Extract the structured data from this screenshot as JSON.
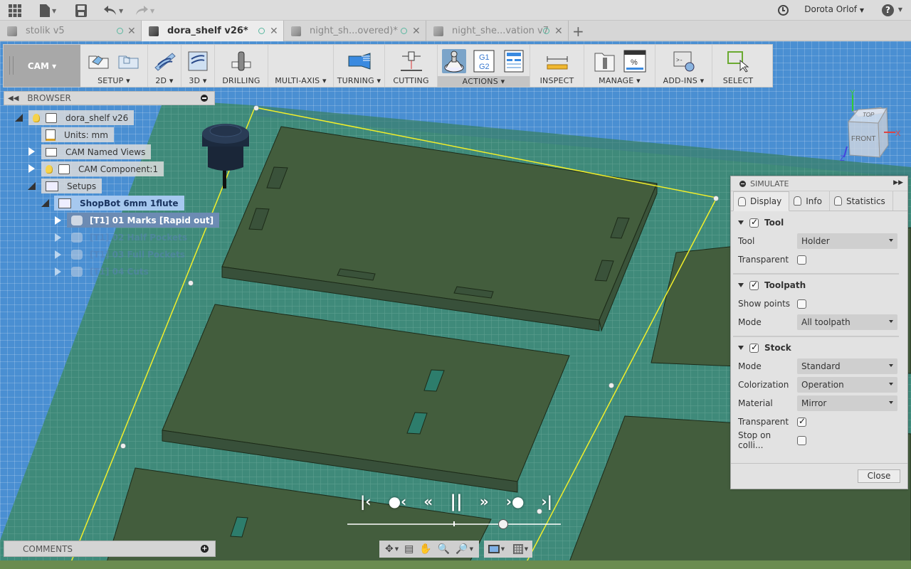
{
  "app_bar": {
    "icons": [
      "apps-grid-icon",
      "file-menu-icon",
      "save-icon",
      "undo-icon",
      "redo-icon"
    ],
    "user_name": "Dorota Orlof",
    "help_label": "?"
  },
  "tabs": [
    {
      "label": "stolik v5",
      "active": false
    },
    {
      "label": "dora_shelf v26*",
      "active": true
    },
    {
      "label": "night_sh...overed)*",
      "active": false
    },
    {
      "label": "night_she...vation v7",
      "active": false
    }
  ],
  "new_tab_label": "+",
  "toolbar": {
    "workspace": "CAM ▾",
    "groups": [
      {
        "label": "SETUP ▾"
      },
      {
        "label": "2D ▾"
      },
      {
        "label": "3D ▾"
      },
      {
        "label": "DRILLING"
      },
      {
        "label": "MULTI-AXIS ▾"
      },
      {
        "label": "TURNING ▾"
      },
      {
        "label": "CUTTING"
      },
      {
        "label": "ACTIONS ▾"
      },
      {
        "label": "INSPECT"
      },
      {
        "label": "MANAGE ▾"
      },
      {
        "label": "ADD-INS ▾"
      },
      {
        "label": "SELECT"
      }
    ],
    "actions_g_code": [
      "G1",
      "G2"
    ],
    "manage_percent": "%"
  },
  "browser": {
    "title": "BROWSER",
    "tree": [
      {
        "label": "dora_shelf v26",
        "state": "open"
      },
      {
        "label": "Units: mm"
      },
      {
        "label": "CAM Named Views",
        "state": "closed"
      },
      {
        "label": "CAM Component:1",
        "state": "closed"
      },
      {
        "label": "Setups",
        "state": "open"
      },
      {
        "label": "ShopBot 6mm 1flute",
        "state": "open"
      },
      {
        "label": "[T1] 01 Marks [Rapid out]",
        "state": "closed",
        "selected": true
      },
      {
        "label": "[T1] 02 Half Pockets",
        "state": "closed",
        "dimmed": true
      },
      {
        "label": "[T1] 03 Full Pockets",
        "state": "closed",
        "dimmed": true
      },
      {
        "label": "[T1] 04 Cuts",
        "state": "closed",
        "dimmed": true
      }
    ]
  },
  "comments": {
    "title": "COMMENTS"
  },
  "view_cube": {
    "top": "TOP",
    "front": "FRONT",
    "axes": [
      "Y",
      "X",
      "Z"
    ]
  },
  "simulate": {
    "title": "SIMULATE",
    "tabs": [
      {
        "label": "Display",
        "active": true
      },
      {
        "label": "Info",
        "active": false
      },
      {
        "label": "Statistics",
        "active": false
      }
    ],
    "tool_section": {
      "title": "Tool",
      "enabled": true,
      "tool_label": "Tool",
      "tool_value": "Holder",
      "transparent_label": "Transparent",
      "transparent": false
    },
    "toolpath_section": {
      "title": "Toolpath",
      "enabled": true,
      "show_points_label": "Show points",
      "show_points": false,
      "mode_label": "Mode",
      "mode_value": "All toolpath"
    },
    "stock_section": {
      "title": "Stock",
      "enabled": true,
      "mode_label": "Mode",
      "mode_value": "Standard",
      "colorization_label": "Colorization",
      "colorization_value": "Operation",
      "material_label": "Material",
      "material_value": "Mirror",
      "transparent_label": "Transparent",
      "transparent": true,
      "stop_label": "Stop on colli...",
      "stop_on_collision": false
    },
    "close_label": "Close"
  },
  "playback": {
    "buttons": [
      "|‹",
      "●‹",
      "«",
      "||",
      "»",
      "›●",
      "›|"
    ],
    "progress_fraction": 0.73,
    "marker_fraction": 0.5
  },
  "colors": {
    "viewport_blue": "#4a8fd2",
    "stock_teal": "#3e8a78",
    "part_green": "#425c3c",
    "toolpath_yellow": "#f2ef2a",
    "selection_blue": "#a6c8ef"
  }
}
